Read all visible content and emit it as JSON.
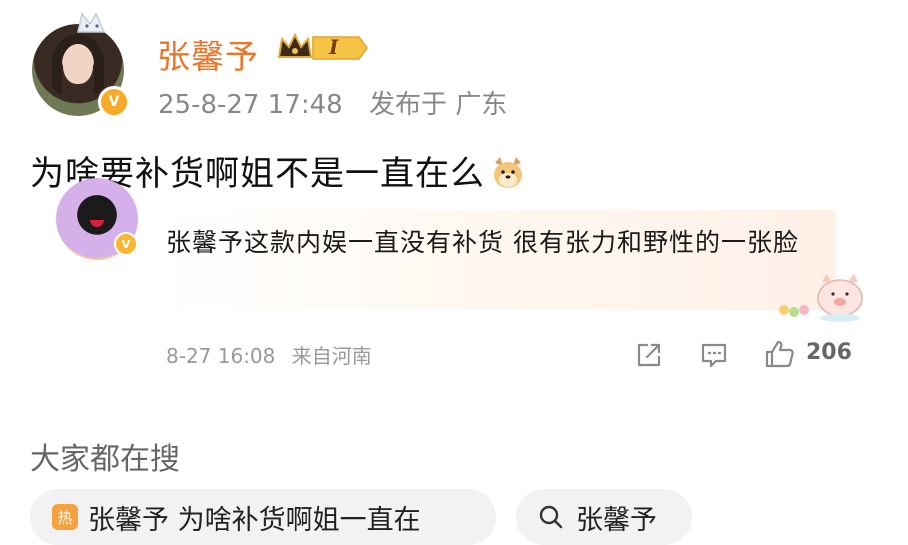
{
  "post": {
    "username": "张馨予",
    "member_level": "I",
    "timestamp": "25-8-27 17:48",
    "location": "发布于 广东",
    "text": "为啥要补货啊姐不是一直在么"
  },
  "quoted_comment": {
    "text": "张馨予这款内娱一直没有补货 很有张力和野性的一张脸",
    "timestamp": "8-27 16:08",
    "source": "来自河南",
    "like_count": "206"
  },
  "search_section": {
    "title": "大家都在搜",
    "chips": [
      {
        "label": "张馨予 为啥补货啊姐一直在",
        "icon": "hot-icon"
      },
      {
        "label": "张馨予",
        "icon": "search-icon"
      }
    ]
  },
  "colors": {
    "accent": "#e8772e",
    "meta_text": "#888888",
    "verified": "#f7a928"
  }
}
